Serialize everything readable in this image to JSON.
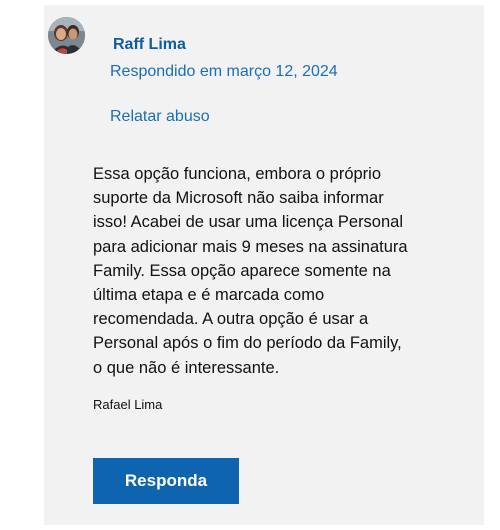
{
  "post": {
    "author_name": "Raff Lima",
    "reply_date": "Respondido em março 12, 2024",
    "report_link": "Relatar abuso",
    "body": "Essa opção funciona, embora o próprio\nsuporte da Microsoft não saiba informar\nisso! Acabei de usar uma licença Personal\npara adicionar mais 9 meses na assinatura\nFamily. Essa opção aparece somente na\núltima etapa e é marcada como\nrecomendada. A outra opção é usar a\nPersonal após o fim do período da Family,\no que não é interessante.",
    "signature": "Rafael Lima"
  },
  "actions": {
    "reply_label": "Responda"
  },
  "colors": {
    "link": "#1a6fb8",
    "button": "#0f64b0",
    "card_background": "#f2f2f2"
  }
}
